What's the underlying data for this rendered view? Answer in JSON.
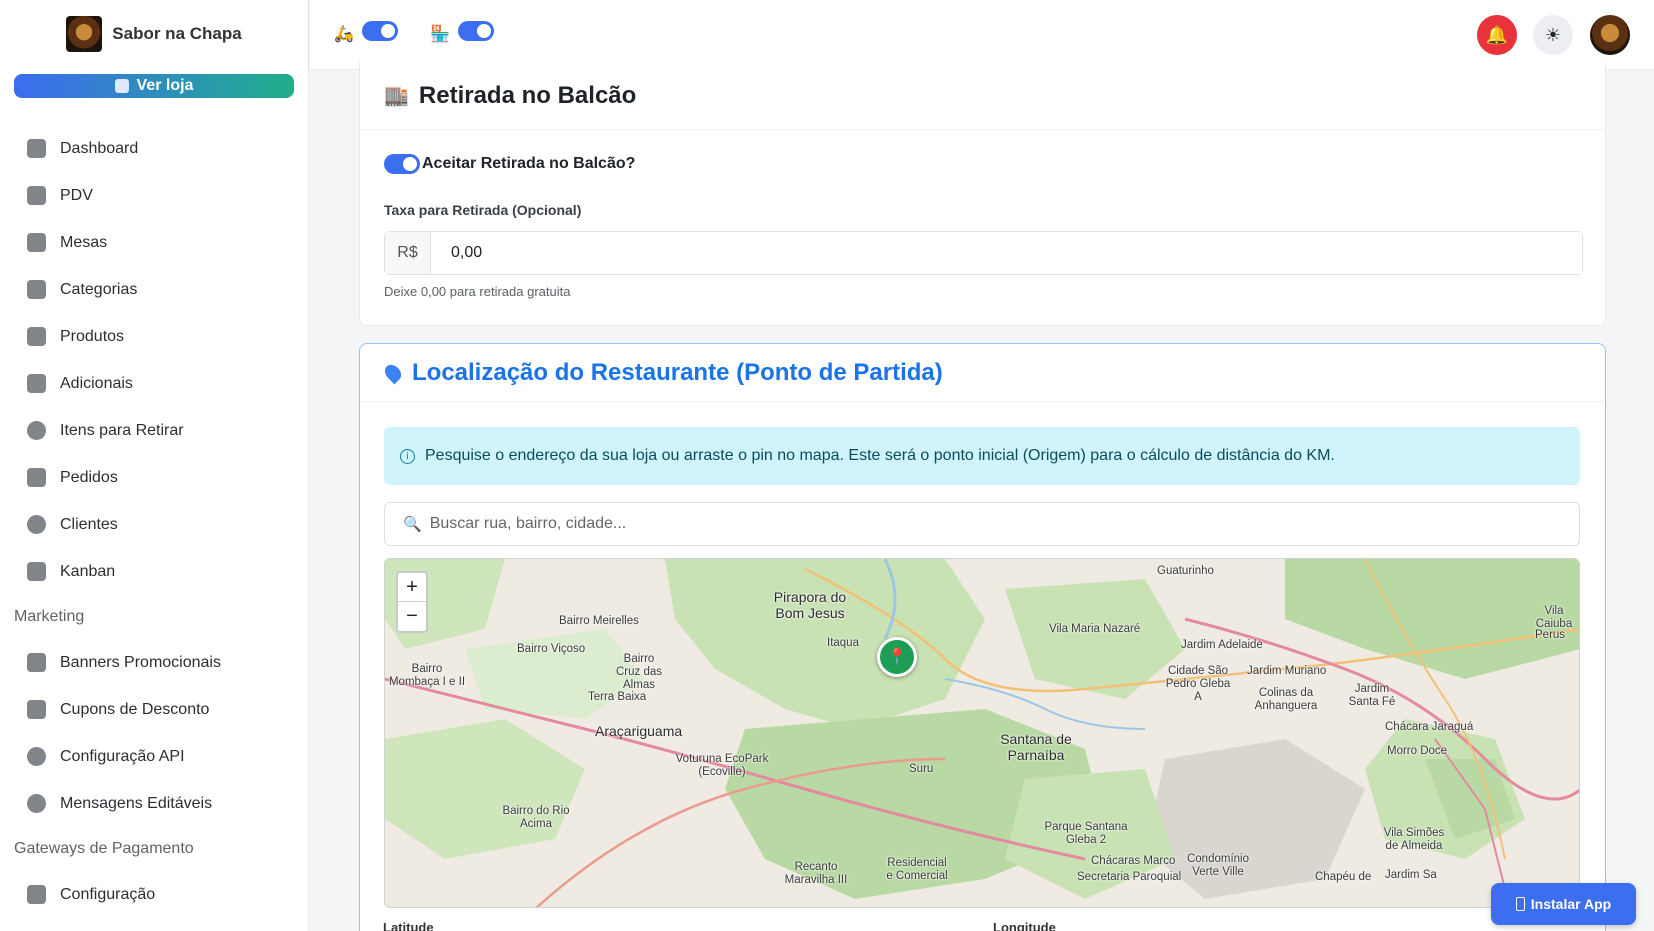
{
  "brand": {
    "name": "Sabor na Chapa"
  },
  "sidebar": {
    "store_button": "Ver loja",
    "items": [
      {
        "label": "Dashboard",
        "icon": "home-icon"
      },
      {
        "label": "PDV",
        "icon": "calculator-icon"
      },
      {
        "label": "Mesas",
        "icon": "couch-icon"
      },
      {
        "label": "Categorias",
        "icon": "grid-icon"
      },
      {
        "label": "Produtos",
        "icon": "bag-icon"
      },
      {
        "label": "Adicionais",
        "icon": "layers-icon"
      },
      {
        "label": "Itens para Retirar",
        "icon": "minus-circle-icon"
      },
      {
        "label": "Pedidos",
        "icon": "cart-icon"
      },
      {
        "label": "Clientes",
        "icon": "users-icon"
      },
      {
        "label": "Kanban",
        "icon": "clipboard-icon"
      }
    ],
    "marketing_section": "Marketing",
    "marketing_items": [
      {
        "label": "Banners Promocionais",
        "icon": "image-icon"
      },
      {
        "label": "Cupons de Desconto",
        "icon": "ticket-icon"
      },
      {
        "label": "Configuração API",
        "icon": "whatsapp-icon"
      },
      {
        "label": "Mensagens Editáveis",
        "icon": "chat-icon"
      }
    ],
    "gateways_section": "Gateways de Pagamento",
    "gateway_items": [
      {
        "label": "Configuração",
        "icon": "card-icon"
      }
    ]
  },
  "topbar": {
    "toggle1_on": true,
    "toggle2_on": true
  },
  "pickup": {
    "title": "Retirada no Balcão",
    "accept_label": "Aceitar Retirada no Balcão?",
    "accept_on": true,
    "fee_label": "Taxa para Retirada (Opcional)",
    "currency": "R$",
    "fee_value": "0,00",
    "help": "Deixe 0,00 para retirada gratuita"
  },
  "location": {
    "title": "Localização do Restaurante (Ponto de Partida)",
    "info": "Pesquise o endereço da sua loja ou arraste o pin no mapa. Este será o ponto inicial (Origem) para o cálculo de distância do KM.",
    "search_placeholder": "Buscar rua, bairro, cidade...",
    "zoom_in": "+",
    "zoom_out": "−",
    "lat_label": "Latitude",
    "lng_label": "Longitude",
    "places": [
      "Pirapora do Bom Jesus",
      "Guaturinho",
      "Bairro Meirelles",
      "Bairro Viçoso",
      "Bairro Cruz das Almas",
      "Bairro Mombaça I e II",
      "Terra Baixa",
      "Araçariguama",
      "Itaqua",
      "Vila Maria Nazaré",
      "Jardim Adelaide",
      "Cidade São Pedro Gleba A",
      "Jardim Muriano",
      "Colinas da Anhanguera",
      "Jardim Santa Fé",
      "Vila Caiuba",
      "Perus",
      "Chácara Jaraguá",
      "Morro Doce",
      "Santana de Parnaíba",
      "Voturuna EcoPark (Ecoville)",
      "Suru",
      "Bairro do Rio Acima",
      "Parque Santana Gleba 2",
      "Chácaras Marco",
      "Condomínio Verte Ville",
      "Recanto Maravilha III",
      "Residencial e Comercial",
      "Secretaria Paroquial",
      "Vila Simões de Almeida",
      "Chapéu de",
      "Jardim Sa"
    ]
  },
  "install_button": "Instalar App",
  "colors": {
    "accent": "#3b6ff0",
    "danger": "#e8323c",
    "info_bg": "#cff4fc",
    "map_green": "#b9d9a4"
  }
}
